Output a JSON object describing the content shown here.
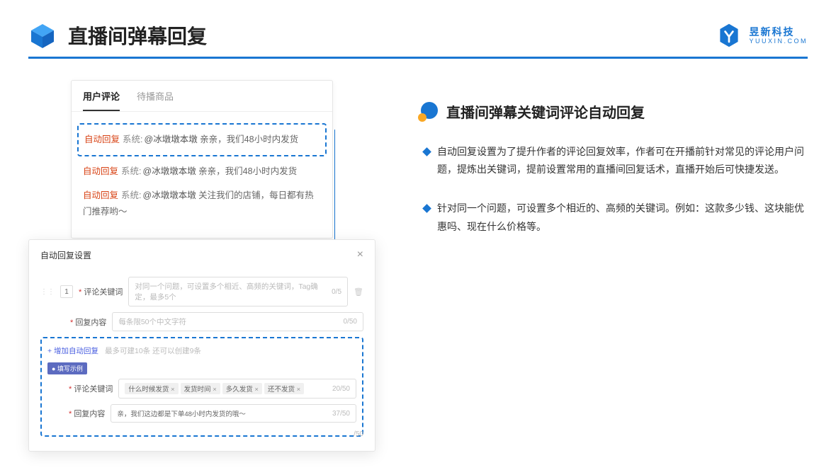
{
  "header": {
    "title": "直播间弹幕回复",
    "brand_cn": "昱新科技",
    "brand_en": "YUUXIN.COM"
  },
  "comments_card": {
    "tabs": {
      "active": "用户评论",
      "other": "待播商品"
    },
    "items": [
      {
        "auto": "自动回复",
        "sys": "系统:",
        "mention": "@冰墩墩本墩",
        "text": " 亲亲，我们48小时内发货"
      },
      {
        "auto": "自动回复",
        "sys": "系统:",
        "mention": "@冰墩墩本墩",
        "text": " 亲亲，我们48小时内发货"
      },
      {
        "auto": "自动回复",
        "sys": "系统:",
        "mention": "@冰墩墩本墩",
        "text": " 关注我们的店铺，每日都有热门推荐哟～"
      }
    ]
  },
  "settings": {
    "title": "自动回复设置",
    "order": "1",
    "keyword_label": "评论关键词",
    "keyword_placeholder": "对同一个问题，可设置多个相近、高频的关键词，Tag确定，最多5个",
    "keyword_counter": "0/5",
    "reply_label": "回复内容",
    "reply_placeholder": "每条限50个中文字符",
    "reply_counter": "0/50",
    "add_link": "+ 增加自动回复",
    "add_hint": "最多可建10条 还可以创建9条",
    "example_badge": "● 填写示例",
    "ex_keyword_label": "评论关键词",
    "ex_tags": [
      "什么时候发货",
      "发货时间",
      "多久发货",
      "还不发货"
    ],
    "ex_keyword_counter": "20/50",
    "ex_reply_label": "回复内容",
    "ex_reply_text": "亲，我们这边都是下单48小时内发货的哦～",
    "ex_reply_counter": "37/50",
    "bottom_extra_counter": "/50"
  },
  "right": {
    "section_title": "直播间弹幕关键词评论自动回复",
    "bullets": [
      "自动回复设置为了提升作者的评论回复效率，作者可在开播前针对常见的评论用户问题，提炼出关键词，提前设置常用的直播间回复话术，直播开始后可快捷发送。",
      "针对同一个问题，可设置多个相近的、高频的关键词。例如：这款多少钱、这块能优惠吗、现在什么价格等。"
    ]
  }
}
